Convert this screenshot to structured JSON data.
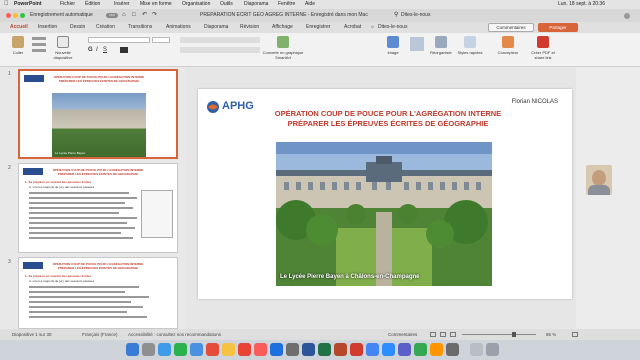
{
  "menubar": {
    "app_name": "PowerPoint",
    "items": [
      "Fichier",
      "Édition",
      "Insérer",
      "Mise en forme",
      "Organisation",
      "Outils",
      "Diaporama",
      "Fenêtre",
      "Aide"
    ],
    "datetime": "Lun. 18 sept. à 20:36"
  },
  "titlebar": {
    "autosave_label": "Enregistrement automatique",
    "autosave_state": "OUI",
    "document_title": "PREPARATION ECRIT GEO AGREG INTERNE  - Enregistré dans mon Mac",
    "search_placeholder": "Dites-le-nous"
  },
  "tabs": {
    "items": [
      "Accueil",
      "Insertion",
      "Dessin",
      "Création",
      "Transitions",
      "Animations",
      "Diaporama",
      "Révision",
      "Affichage",
      "Enregistrer",
      "Acrobat"
    ],
    "tell_me": "Dites-le-nous",
    "comments_button": "Commentaires",
    "share_button": "Partager"
  },
  "ribbon": {
    "paste": "Coller",
    "new_slide": "Nouvelle diapositive",
    "convert_smartart": "Convertir en graphique SmartArt",
    "image": "Image",
    "arrange": "Réorganiser",
    "quick_styles": "Styles rapides",
    "designer": "Concepteur",
    "create_pdf": "Créer PDF et share link"
  },
  "thumbnails": [
    {
      "number": "1",
      "title": "OPÉRATION COUP DE POUCE POUR L'AGRÉGATION INTERNE",
      "subtitle": "PRÉPARER LES ÉPREUVES ÉCRITES DE GÉOGRAPHIE",
      "caption": "Le Lycée Pierre Bayen"
    },
    {
      "number": "2",
      "title": "OPÉRATION COUP DE POUCE POUR L'AGRÉGATION INTERNE",
      "subtitle": "PRÉPARER LES ÉPREUVES ÉCRITES DE GÉOGRAPHIE",
      "section": "1- Se préparer en suivant des épreuves écrites",
      "point": "A. Lire les rapports de jury des sessions passées"
    },
    {
      "number": "3",
      "title": "OPÉRATION COUP DE POUCE POUR L'AGRÉGATION INTERNE",
      "subtitle": "PRÉPARER LES ÉPREUVES ÉCRITES DE GÉOGRAPHIE",
      "section": "1- Se préparer en suivant des épreuves écrites",
      "point": "A. Lire les rapports de jury des sessions passées"
    }
  ],
  "slide": {
    "logo_text": "APHG",
    "author": "Florian NICOLAS",
    "title_line1": "OPÉRATION COUP DE POUCE POUR L'AGRÉGATION INTERNE",
    "title_line2": "PRÉPARER LES ÉPREUVES ÉCRITES DE GÉOGRAPHIE",
    "photo_caption": "Le Lycée Pierre Bayen à Châlons-en-Champagne"
  },
  "statusbar": {
    "slide_info": "Diapositive 1 sur 30",
    "language": "Français (France)",
    "accessibility": "Accessibilité : consultez nos recommandations",
    "notes": "Commentaires",
    "zoom": "86 %"
  },
  "colors": {
    "accent": "#b7472a",
    "title_red": "#c0392b",
    "share_orange": "#d9643a"
  }
}
